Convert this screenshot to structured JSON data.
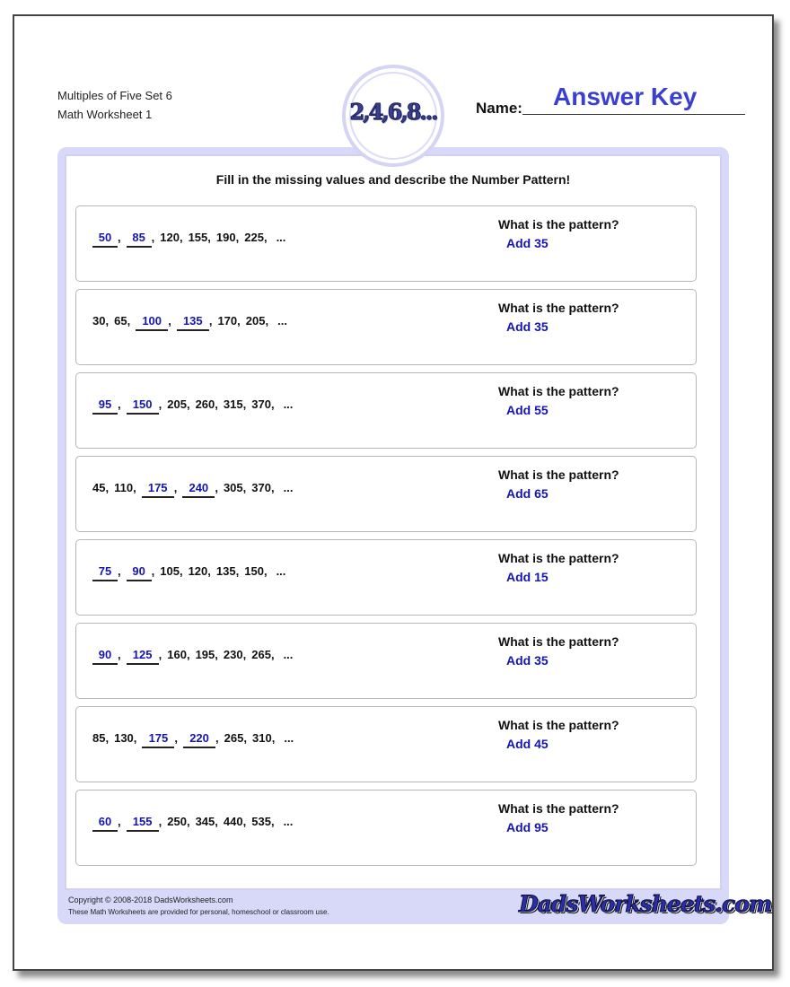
{
  "header": {
    "title_line1": "Multiples of Five Set 6",
    "title_line2": "Math Worksheet 1",
    "logo_text": "2,4,6,8...",
    "name_label": "Name:",
    "name_value": "Answer Key"
  },
  "instructions": "Fill in the missing values and describe the Number Pattern!",
  "question_label": "What is the pattern?",
  "problems": [
    {
      "terms": [
        {
          "v": "50",
          "blank": true
        },
        {
          "v": "85",
          "blank": true
        },
        {
          "v": "120"
        },
        {
          "v": "155"
        },
        {
          "v": "190"
        },
        {
          "v": "225"
        }
      ],
      "answer": "Add 35"
    },
    {
      "terms": [
        {
          "v": "30"
        },
        {
          "v": "65"
        },
        {
          "v": "100",
          "blank": true
        },
        {
          "v": "135",
          "blank": true
        },
        {
          "v": "170"
        },
        {
          "v": "205"
        }
      ],
      "answer": "Add 35"
    },
    {
      "terms": [
        {
          "v": "95",
          "blank": true
        },
        {
          "v": "150",
          "blank": true
        },
        {
          "v": "205"
        },
        {
          "v": "260"
        },
        {
          "v": "315"
        },
        {
          "v": "370"
        }
      ],
      "answer": "Add 55"
    },
    {
      "terms": [
        {
          "v": "45"
        },
        {
          "v": "110"
        },
        {
          "v": "175",
          "blank": true
        },
        {
          "v": "240",
          "blank": true
        },
        {
          "v": "305"
        },
        {
          "v": "370"
        }
      ],
      "answer": "Add 65"
    },
    {
      "terms": [
        {
          "v": "75",
          "blank": true
        },
        {
          "v": "90",
          "blank": true
        },
        {
          "v": "105"
        },
        {
          "v": "120"
        },
        {
          "v": "135"
        },
        {
          "v": "150"
        }
      ],
      "answer": "Add 15"
    },
    {
      "terms": [
        {
          "v": "90",
          "blank": true
        },
        {
          "v": "125",
          "blank": true
        },
        {
          "v": "160"
        },
        {
          "v": "195"
        },
        {
          "v": "230"
        },
        {
          "v": "265"
        }
      ],
      "answer": "Add 35"
    },
    {
      "terms": [
        {
          "v": "85"
        },
        {
          "v": "130"
        },
        {
          "v": "175",
          "blank": true
        },
        {
          "v": "220",
          "blank": true
        },
        {
          "v": "265"
        },
        {
          "v": "310"
        }
      ],
      "answer": "Add 45"
    },
    {
      "terms": [
        {
          "v": "60",
          "blank": true
        },
        {
          "v": "155",
          "blank": true
        },
        {
          "v": "250"
        },
        {
          "v": "345"
        },
        {
          "v": "440"
        },
        {
          "v": "535"
        }
      ],
      "answer": "Add 95"
    }
  ],
  "ellipsis": "...",
  "footer": {
    "copyright": "Copyright © 2008-2018 DadsWorksheets.com",
    "usage": "These Math Worksheets are provided for personal, homeschool or classroom use.",
    "brand": "DadsWorksheets.com"
  },
  "colors": {
    "answer_blue": "#1515b0",
    "name_blue": "#3b3fd0",
    "frame_lavender": "#d8d8f8"
  }
}
